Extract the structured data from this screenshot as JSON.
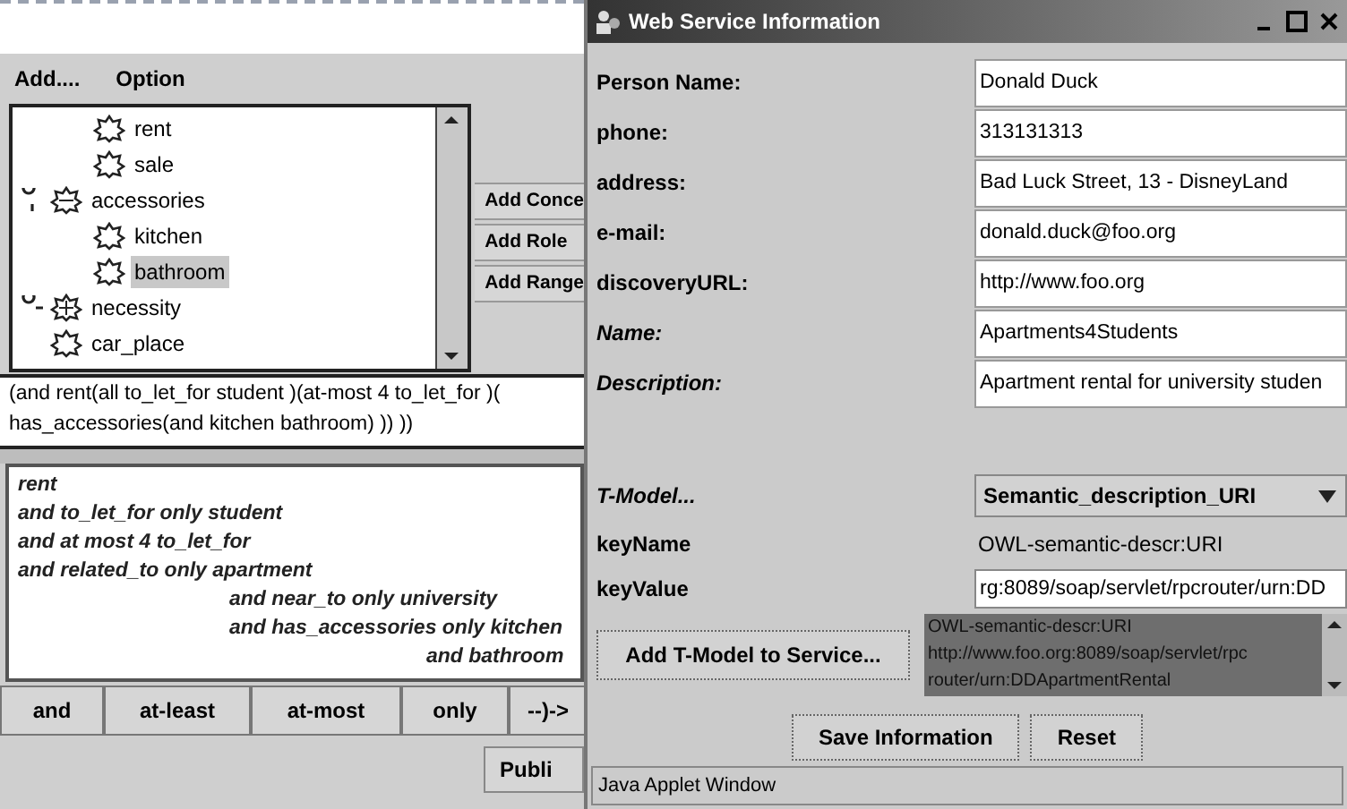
{
  "menu": [
    "Add....",
    "Option"
  ],
  "tree": {
    "continued": [
      {
        "label": "rent",
        "selected": false
      },
      {
        "label": "sale",
        "selected": false
      }
    ],
    "items": [
      {
        "label": "accessories",
        "selected": false,
        "expanded": true,
        "children": [
          {
            "label": "kitchen",
            "selected": false
          },
          {
            "label": "bathroom",
            "selected": true
          }
        ]
      },
      {
        "label": "necessity",
        "selected": false,
        "expanded": false
      },
      {
        "label": "car_place",
        "selected": false
      }
    ]
  },
  "side_buttons": [
    "Add Conce",
    "Add Role",
    "Add Range"
  ],
  "expression": [
    "(and rent(all to_let_for student )(at-most 4  to_let_for )(",
    "has_accessories(and kitchen bathroom) )) ))"
  ],
  "description_lines": [
    {
      "text": "rent"
    },
    {
      "text": "and  to_let_for only student"
    },
    {
      "text": "and at most 4  to_let_for"
    },
    {
      "text": "and  related_to only apartment",
      "children": [
        {
          "text": "and  near_to only university"
        },
        {
          "text": "and  has_accessories only kitchen",
          "children": [
            {
              "text": "and bathroom"
            }
          ]
        }
      ]
    }
  ],
  "operator_buttons": [
    "and",
    "at-least",
    "at-most",
    "only",
    "--)->"
  ],
  "publish_button": "Publi",
  "window": {
    "title": "Web Service Information",
    "fields": [
      {
        "label": "Person Name:",
        "italic": false,
        "value": "Donald Duck"
      },
      {
        "label": "phone:",
        "italic": false,
        "value": "313131313"
      },
      {
        "label": "address:",
        "italic": false,
        "value": "Bad Luck Street, 13 - DisneyLand"
      },
      {
        "label": "e-mail:",
        "italic": false,
        "value": "donald.duck@foo.org"
      },
      {
        "label": "discoveryURL:",
        "italic": false,
        "value": "http://www.foo.org"
      },
      {
        "label": "Name:",
        "italic": true,
        "value": "Apartments4Students"
      },
      {
        "label": "Description:",
        "italic": true,
        "value": "Apartment rental for university studen"
      }
    ],
    "tmodel": {
      "label": "T-Model...",
      "value": "Semantic_description_URI"
    },
    "key_name": {
      "label": "keyName",
      "value": "OWL-semantic-descr:URI"
    },
    "key_value": {
      "label": "keyValue",
      "value": "rg:8089/soap/servlet/rpcrouter/urn:DD"
    },
    "add_tmodel_button": "Add T-Model to Service...",
    "tmodel_list": [
      "OWL-semantic-descr:URI",
      "http://www.foo.org:8089/soap/servlet/rpc",
      "router/urn:DDApartmentRental"
    ],
    "buttons": [
      "Save Information",
      "Reset"
    ],
    "status_bar": "Java Applet Window"
  }
}
